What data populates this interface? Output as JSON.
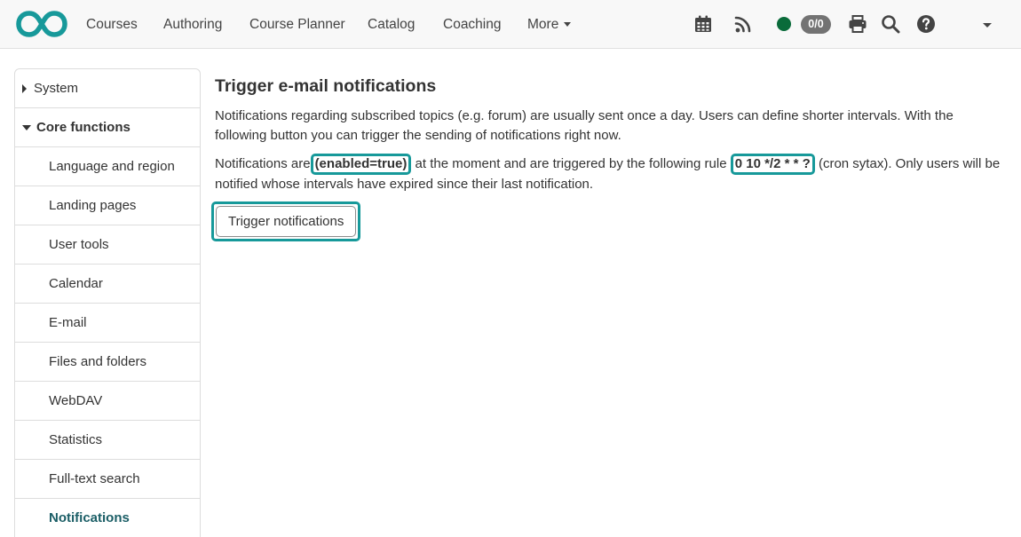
{
  "nav": {
    "items": [
      {
        "id": "courses",
        "label": "Courses"
      },
      {
        "id": "authoring",
        "label": "Authoring"
      },
      {
        "id": "course-planner",
        "label": "Course Planner"
      },
      {
        "id": "catalog",
        "label": "Catalog"
      },
      {
        "id": "coaching",
        "label": "Coaching"
      }
    ],
    "more_label": "More",
    "badge": "0/0",
    "brand_color": "#17999a",
    "status_color": "#0a6b3a"
  },
  "sidebar": {
    "items": [
      {
        "label": "System"
      },
      {
        "label": "Core functions"
      },
      {
        "label": "Language and region"
      },
      {
        "label": "Landing pages"
      },
      {
        "label": "User tools"
      },
      {
        "label": "Calendar"
      },
      {
        "label": "E-mail"
      },
      {
        "label": "Files and folders"
      },
      {
        "label": "WebDAV"
      },
      {
        "label": "Statistics"
      },
      {
        "label": "Full-text search"
      },
      {
        "label": "Notifications"
      }
    ]
  },
  "main": {
    "title": "Trigger e-mail notifications",
    "intro": "Notifications regarding subscribed topics (e.g. forum) are usually sent once a day. Users can define shorter intervals. With the following button you can trigger the sending of notifications right now.",
    "status_prefix": "Notifications are",
    "status_value": "(enabled=true)",
    "status_middle": "at the moment and are triggered by the following rule",
    "cron_rule": "0 10 */2 * * ?",
    "status_suffix": "(cron sytax). Only users will be notified whose intervals have expired since their last notification.",
    "trigger_button": "Trigger notifications"
  }
}
